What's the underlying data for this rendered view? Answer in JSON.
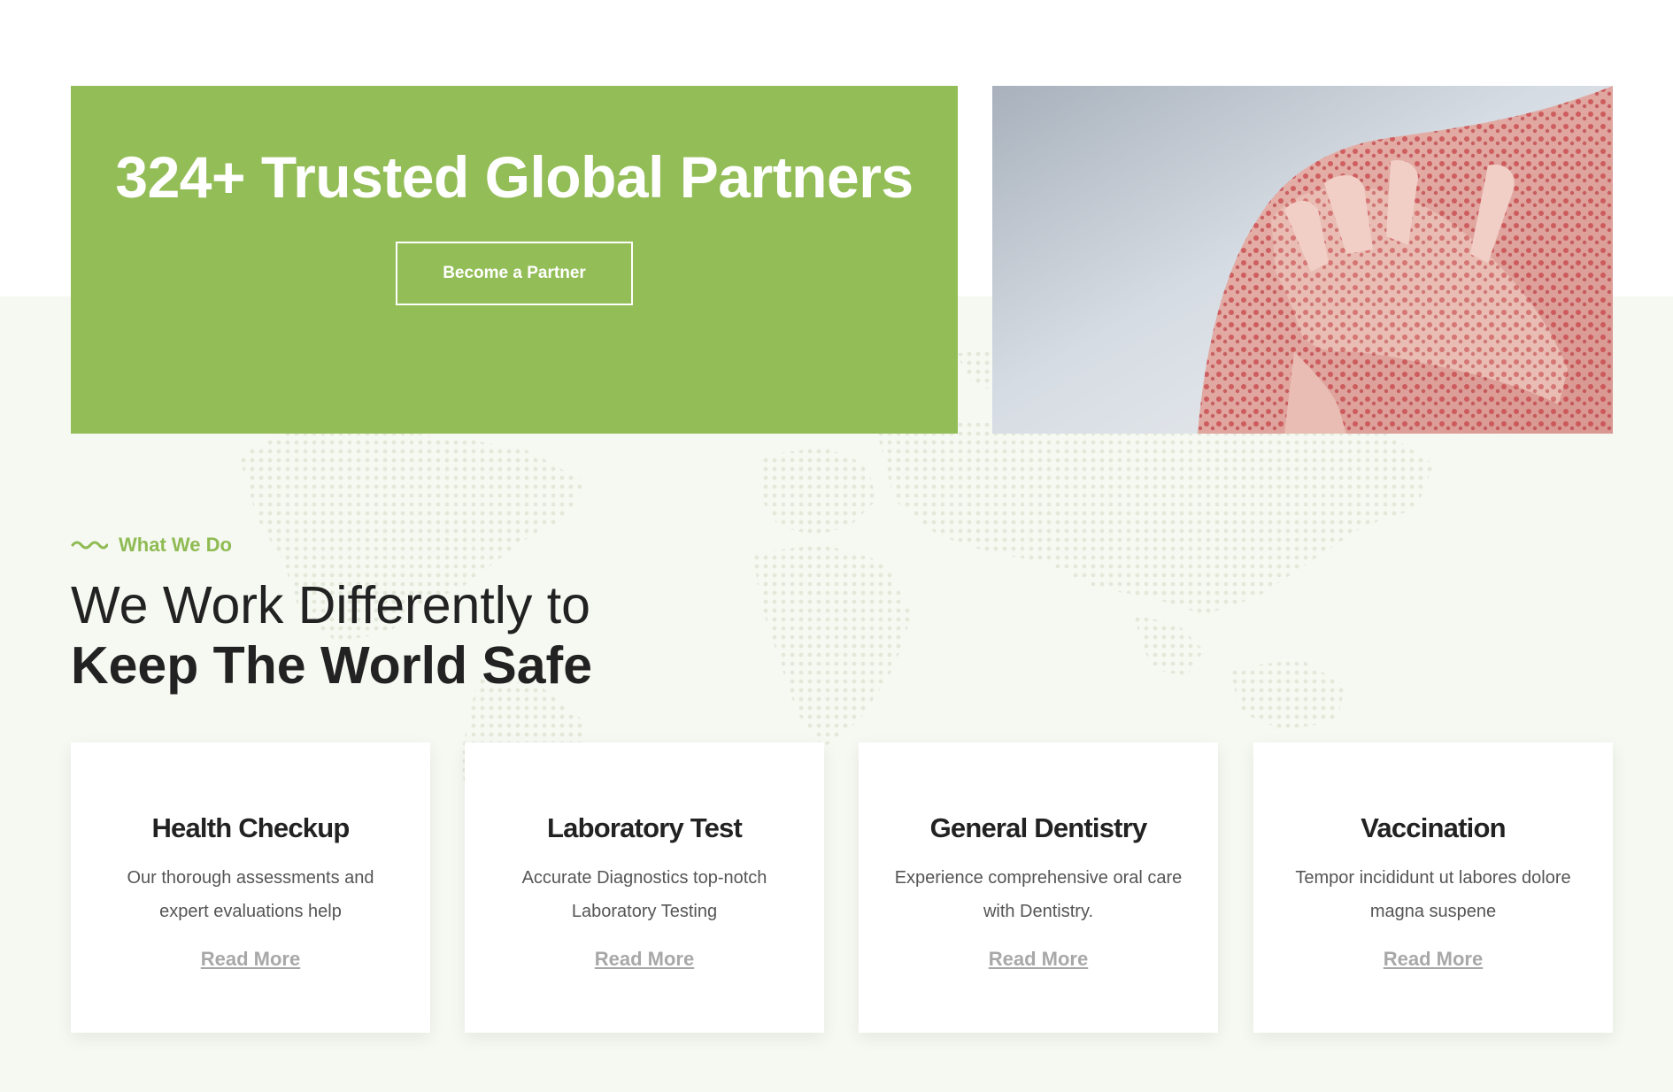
{
  "colors": {
    "accent_green": "#93bd57",
    "light_background": "#f6f8f2",
    "heading_text": "#222222",
    "body_text": "#555555",
    "link_text": "#a8a8a8"
  },
  "partners": {
    "title": "324+ Trusted Global Partners",
    "button_label": "Become a Partner"
  },
  "hero_image": {
    "subject": "Hand resting on shoulder with red irritated skin",
    "icon": "skin-condition-photo"
  },
  "what_we_do": {
    "tag_icon": "wave-icon",
    "tag_label": "What We Do",
    "heading_line1": "We Work Differently to",
    "heading_line2": "Keep The World Safe"
  },
  "services": [
    {
      "title": "Health Checkup",
      "description": "Our thorough assessments and expert evaluations help",
      "link_label": "Read More"
    },
    {
      "title": "Laboratory Test",
      "description": "Accurate Diagnostics top-notch Laboratory Testing",
      "link_label": "Read More"
    },
    {
      "title": "General Dentistry",
      "description": "Experience comprehensive oral care with Dentistry.",
      "link_label": "Read More"
    },
    {
      "title": "Vaccination",
      "description": "Tempor incididunt ut labores dolore magna suspene",
      "link_label": "Read More"
    }
  ]
}
